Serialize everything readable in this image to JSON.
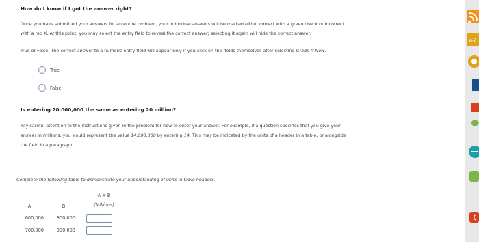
{
  "question1": {
    "title": "How do I know if I got the answer right?",
    "paragraph1_line1": "Once you have submitted your answers for an entire problem, your individual answers will be marked either correct with a green check or incorrect",
    "paragraph1_line2": "with a red X. At this point, you may select the entry field to reveal the correct answer; selecting it again will hide the correct answer.",
    "paragraph2_prefix": "True or False: The correct answer to a numeric entry field will appear only if you click on the fields themselves after selecting ",
    "paragraph2_italic": "Grade It Now",
    "paragraph2_suffix": ".",
    "options": [
      "True",
      "False"
    ]
  },
  "question2": {
    "title": "Is entering 20,000,000 the same as entering 20 million?",
    "line1": "Pay careful attention to the instructions given in the problem for how to enter your answer. For example, if a question specifies that you give your",
    "line2_prefix": "answer in millions, you would represent the value ",
    "line2_value1": "14,000,000",
    "line2_middle": " by entering ",
    "line2_value2": "14",
    "line2_suffix": ". This may be indicated by the units of a header in a table, or alongside",
    "line3": "the field in a paragraph.",
    "instruction": "Complete the following table to demonstrate your understanding of units in table headers."
  },
  "table": {
    "header_a": "A",
    "header_b": "B",
    "header_sum": "A + B",
    "header_units": "(Millions)",
    "rows": [
      {
        "a": "600,000",
        "b": "800,000"
      },
      {
        "a": "700,000",
        "b": "900,000"
      }
    ]
  },
  "sidebar": {
    "az_label": "A-Z",
    "colors": {
      "orange": "#f5901e",
      "blue_dark": "#1a4f8a",
      "teal": "#1aa0a8",
      "green": "#7ab648",
      "red": "#d9401f",
      "gold": "#e0a21a"
    }
  }
}
